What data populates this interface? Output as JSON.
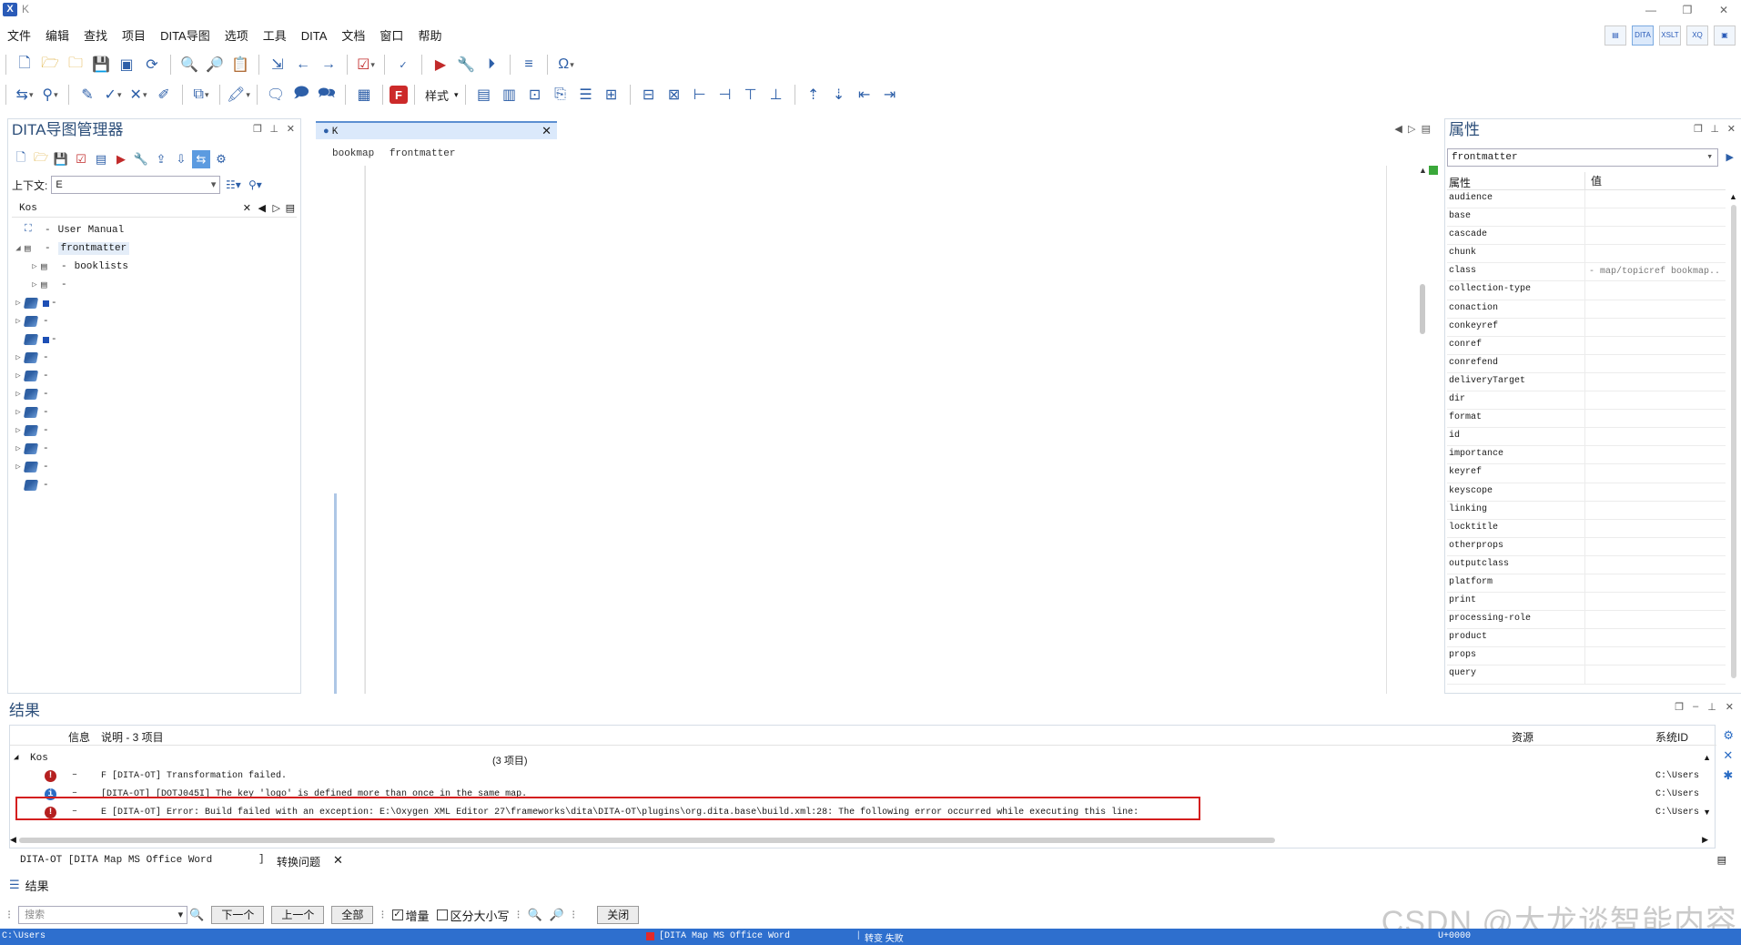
{
  "window": {
    "title": "K",
    "controls": [
      "—",
      "❐",
      "✕"
    ]
  },
  "menu": [
    "文件",
    "编辑",
    "查找",
    "项目",
    "DITA导图",
    "选项",
    "工具",
    "DITA",
    "文档",
    "窗口",
    "帮助"
  ],
  "perspectives": [
    "▤",
    "DITA",
    "XSLT",
    "XQ",
    "▣"
  ],
  "toolbar2": {
    "style_label": "样式"
  },
  "mapmgr": {
    "title": "DITA导图管理器",
    "context_label": "上下文:",
    "context_value": "E",
    "map_tab": "Kos",
    "tree": [
      {
        "level": 0,
        "arrow": "",
        "kind": "map",
        "label": "User Manual"
      },
      {
        "level": 0,
        "arrow": "◢",
        "kind": "frontmatter",
        "label": "frontmatter",
        "selected": true
      },
      {
        "level": 1,
        "arrow": "▷",
        "kind": "booklists",
        "label": "booklists"
      },
      {
        "level": 1,
        "arrow": "▷",
        "kind": "doc",
        "label": ""
      },
      {
        "level": 0,
        "arrow": "▷",
        "kind": "book",
        "label": "",
        "sq": true
      },
      {
        "level": 0,
        "arrow": "▷",
        "kind": "book",
        "label": ""
      },
      {
        "level": 0,
        "arrow": "",
        "kind": "book",
        "label": "",
        "sq": true
      },
      {
        "level": 0,
        "arrow": "▷",
        "kind": "book",
        "label": ""
      },
      {
        "level": 0,
        "arrow": "▷",
        "kind": "book",
        "label": ""
      },
      {
        "level": 0,
        "arrow": "▷",
        "kind": "book",
        "label": ""
      },
      {
        "level": 0,
        "arrow": "▷",
        "kind": "book",
        "label": ""
      },
      {
        "level": 0,
        "arrow": "▷",
        "kind": "book",
        "label": ""
      },
      {
        "level": 0,
        "arrow": "▷",
        "kind": "book",
        "label": ""
      },
      {
        "level": 0,
        "arrow": "▷",
        "kind": "book",
        "label": ""
      },
      {
        "level": 0,
        "arrow": "",
        "kind": "book",
        "label": ""
      }
    ]
  },
  "editor": {
    "tab": "K",
    "breadcrumb": [
      "bookmap",
      "frontmatter"
    ]
  },
  "props": {
    "title": "属性",
    "element": "frontmatter",
    "col_attr": "属性",
    "col_val": "值",
    "rows": [
      {
        "name": "audience",
        "value": ""
      },
      {
        "name": "base",
        "value": ""
      },
      {
        "name": "cascade",
        "value": ""
      },
      {
        "name": "chunk",
        "value": ""
      },
      {
        "name": "class",
        "value": "- map/topicref bookmap..."
      },
      {
        "name": "collection-type",
        "value": ""
      },
      {
        "name": "conaction",
        "value": ""
      },
      {
        "name": "conkeyref",
        "value": ""
      },
      {
        "name": "conref",
        "value": ""
      },
      {
        "name": "conrefend",
        "value": ""
      },
      {
        "name": "deliveryTarget",
        "value": ""
      },
      {
        "name": "dir",
        "value": ""
      },
      {
        "name": "format",
        "value": ""
      },
      {
        "name": "id",
        "value": ""
      },
      {
        "name": "importance",
        "value": ""
      },
      {
        "name": "keyref",
        "value": ""
      },
      {
        "name": "keyscope",
        "value": ""
      },
      {
        "name": "linking",
        "value": ""
      },
      {
        "name": "locktitle",
        "value": ""
      },
      {
        "name": "otherprops",
        "value": ""
      },
      {
        "name": "outputclass",
        "value": ""
      },
      {
        "name": "platform",
        "value": ""
      },
      {
        "name": "print",
        "value": ""
      },
      {
        "name": "processing-role",
        "value": ""
      },
      {
        "name": "product",
        "value": ""
      },
      {
        "name": "props",
        "value": ""
      },
      {
        "name": "query",
        "value": ""
      }
    ]
  },
  "results": {
    "title": "结果",
    "col_info": "信息",
    "col_desc": "说明 - 3 项目",
    "col_resource": "资源",
    "col_sysid": "系统ID",
    "group_label": "Kos",
    "group_count": "(3 项目)",
    "rows": [
      {
        "type": "error",
        "msg": "F [DITA-OT] Transformation failed.",
        "sys": "C:\\Users"
      },
      {
        "type": "info",
        "msg": "[DITA-OT] [DOTJ045I] The key 'logo' is defined more than once in the same map.",
        "sys": "C:\\Users"
      },
      {
        "type": "error",
        "msg": "E [DITA-OT] Error: Build failed with an exception: E:\\Oxygen XML Editor 27\\frameworks\\dita\\DITA-OT\\plugins\\org.dita.base\\build.xml:28: The following error occurred while executing this line:",
        "sys": "C:\\Users"
      }
    ],
    "tab1": "DITA-OT [DITA Map MS Office Word",
    "tab1_end": "]",
    "tab2": "转换问题",
    "results_tab": "结果"
  },
  "search": {
    "placeholder": "搜索",
    "next": "下一个",
    "prev": "上一个",
    "all": "全部",
    "incremental": "增量",
    "case": "区分大小写",
    "close": "关闭"
  },
  "status": {
    "path": "C:\\Users",
    "task": "[DITA Map MS Office Word",
    "result": "转变 失败",
    "unicode": "U+0000"
  },
  "watermark": "CSDN @大龙谈智能内容"
}
